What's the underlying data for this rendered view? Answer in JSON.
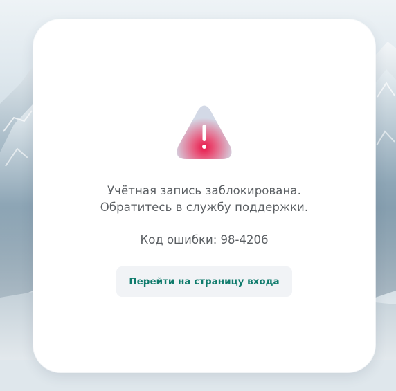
{
  "dialog": {
    "icon": "warning-triangle-icon",
    "message_line1": "Учётная запись заблокирована.",
    "message_line2": "Обратитесь в службу поддержки.",
    "error_code_label": "Код ошибки: 98-4206",
    "login_button_label": "Перейти на страницу входа"
  },
  "colors": {
    "accent_text": "#0f7b6c",
    "warning_red": "#e8174a",
    "button_bg": "#f1f3f6"
  }
}
